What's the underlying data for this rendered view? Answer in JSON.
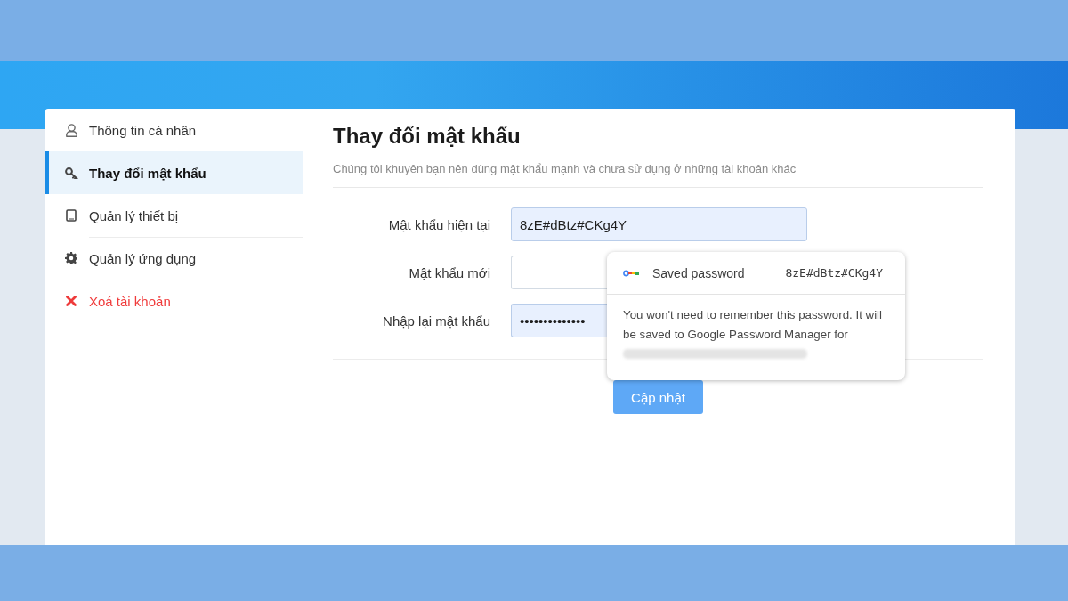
{
  "sidebar": {
    "items": [
      {
        "label": "Thông tin cá nhân",
        "selected": false,
        "kind": "normal"
      },
      {
        "label": "Thay đổi mật khẩu",
        "selected": true,
        "kind": "normal"
      },
      {
        "label": "Quản lý thiết bị",
        "selected": false,
        "kind": "normal"
      },
      {
        "label": "Quản lý ứng dụng",
        "selected": false,
        "kind": "normal"
      },
      {
        "label": "Xoá tài khoản",
        "selected": false,
        "kind": "danger"
      }
    ]
  },
  "form": {
    "title": "Thay đổi mật khẩu",
    "subtitle": "Chúng tôi khuyên bạn nên dùng mật khẩu mạnh và chưa sử dụng ở những tài khoản khác",
    "fields": [
      {
        "label": "Mật khẩu hiện tại",
        "value": "8zE#dBtz#CKg4Y",
        "autofilled": true
      },
      {
        "label": "Mật khẩu mới",
        "autofilled": false
      },
      {
        "label": "Nhập lại mật khẩu",
        "value": "••••••••••••••",
        "autofilled": true
      }
    ],
    "submit_button": "Cập nhật"
  },
  "autofill_popup": {
    "label": "Saved password",
    "value": "8zE#dBtz#CKg4Y",
    "message": "You won't need to remember this password. It will be saved to Google Password Manager for"
  }
}
